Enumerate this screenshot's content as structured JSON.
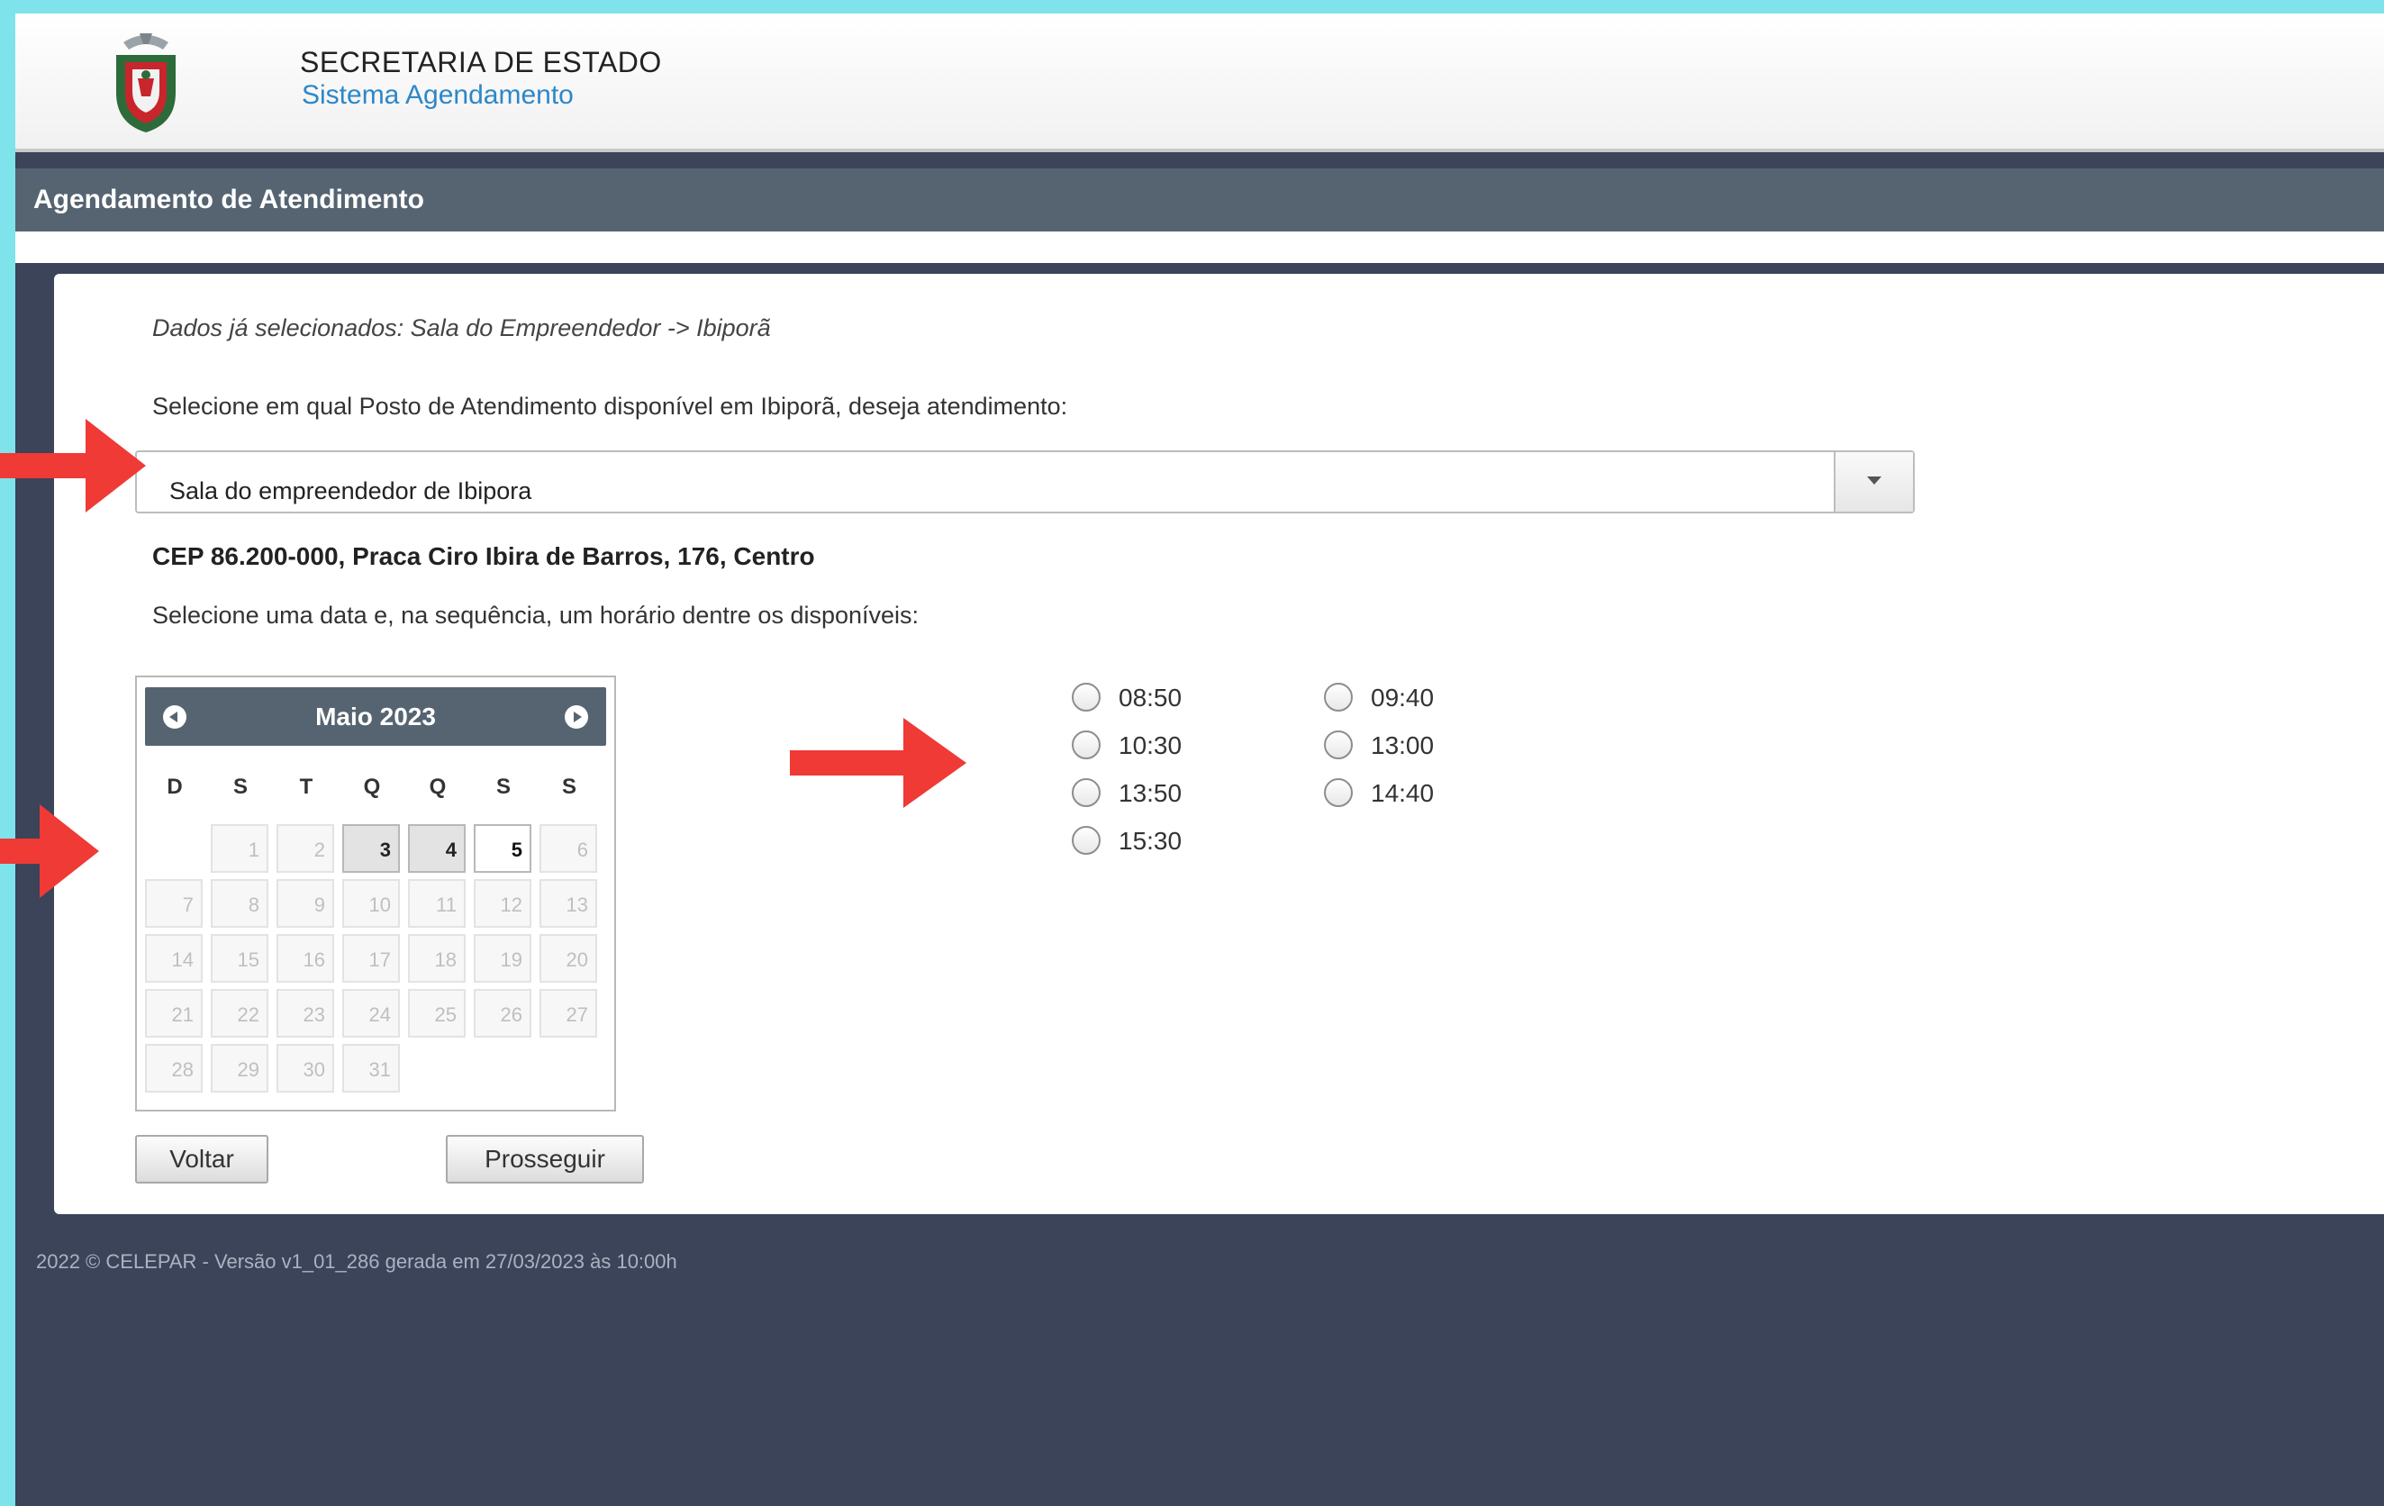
{
  "header": {
    "org": "SECRETARIA DE ESTADO",
    "system": "Sistema Agendamento"
  },
  "titlebar": {
    "title": "Agendamento de Atendimento"
  },
  "form": {
    "already_selected": "Dados já selecionados: Sala do Empreendedor -> Ibiporã",
    "post_prompt": "Selecione em qual Posto de Atendimento disponível em Ibiporã, deseja atendimento:",
    "post_selected": "Sala do empreendedor de Ibipora",
    "address": "CEP 86.200-000, Praca Ciro Ibira de Barros, 176, Centro",
    "date_prompt": "Selecione uma data e, na sequência, um horário dentre os disponíveis:"
  },
  "calendar": {
    "title": "Maio 2023",
    "weekdays": [
      "D",
      "S",
      "T",
      "Q",
      "Q",
      "S",
      "S"
    ],
    "first_weekday_index": 1,
    "days_in_month": 31,
    "available_days": [
      3,
      4,
      5
    ],
    "selected_day": 5
  },
  "time_slots": [
    {
      "time": "08:50"
    },
    {
      "time": "09:40"
    },
    {
      "time": "10:30"
    },
    {
      "time": "13:00"
    },
    {
      "time": "13:50"
    },
    {
      "time": "14:40"
    },
    {
      "time": "15:30"
    }
  ],
  "buttons": {
    "back": "Voltar",
    "proceed": "Prosseguir"
  },
  "footer": {
    "text": "2022 © CELEPAR - Versão v1_01_286 gerada em 27/03/2023 às 10:00h"
  },
  "colors": {
    "annotation_arrow": "#ef3a36",
    "titlebar": "#566472",
    "background": "#3b4458"
  }
}
